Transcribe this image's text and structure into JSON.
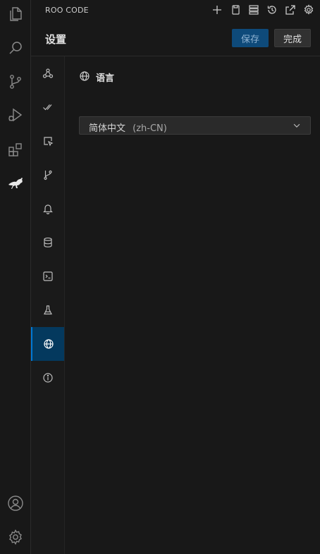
{
  "panel": {
    "title": "ROO CODE"
  },
  "activity_bar": {
    "items": [
      {
        "icon": "files-icon"
      },
      {
        "icon": "search-icon"
      },
      {
        "icon": "source-control-icon"
      },
      {
        "icon": "run-debug-icon"
      },
      {
        "icon": "extensions-icon"
      },
      {
        "icon": "kangaroo-icon"
      }
    ],
    "bottom": [
      {
        "icon": "account-icon"
      },
      {
        "icon": "manage-gear-icon"
      }
    ]
  },
  "top_actions": [
    "plus-icon",
    "copy-icon",
    "server-icon",
    "history-icon",
    "popout-icon",
    "gear-icon"
  ],
  "settings": {
    "title": "设置",
    "save_label": "保存",
    "done_label": "完成"
  },
  "nav": {
    "items": [
      {
        "icon": "webhook-icon"
      },
      {
        "icon": "check-all-icon"
      },
      {
        "icon": "select-cursor-icon"
      },
      {
        "icon": "git-branch-icon"
      },
      {
        "icon": "bell-icon"
      },
      {
        "icon": "database-icon"
      },
      {
        "icon": "terminal-icon"
      },
      {
        "icon": "flask-icon"
      },
      {
        "icon": "globe-icon",
        "active": true
      },
      {
        "icon": "info-icon"
      }
    ]
  },
  "language": {
    "section_title": "语言",
    "selected_name": "简体中文",
    "selected_code": "(zh-CN)"
  },
  "colors": {
    "accent": "#0078d4",
    "active_bg": "#04395e",
    "save_bg": "#0e4a7a"
  }
}
